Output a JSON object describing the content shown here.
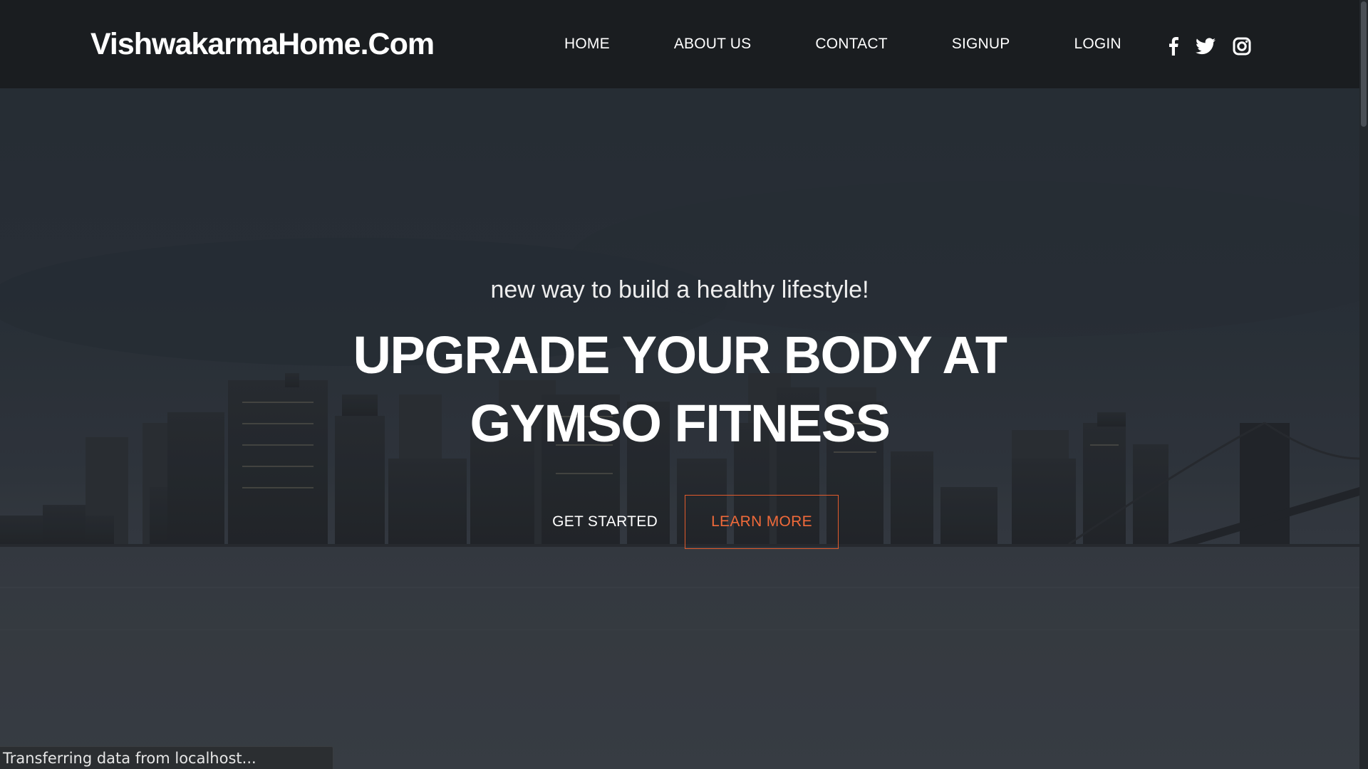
{
  "brand": {
    "name": "VishwakarmaHome.Com"
  },
  "nav": {
    "items": [
      {
        "label": "HOME"
      },
      {
        "label": "ABOUT US"
      },
      {
        "label": "CONTACT"
      },
      {
        "label": "SIGNUP"
      },
      {
        "label": "LOGIN"
      }
    ]
  },
  "social": {
    "icons": [
      "facebook-icon",
      "twitter-icon",
      "instagram-icon"
    ]
  },
  "hero": {
    "subtitle": "new way to build a healthy lifestyle!",
    "headline_line1": "UPGRADE YOUR BODY AT",
    "headline_line2": "GYMSO FITNESS",
    "primary_button": "GET STARTED",
    "secondary_button": "LEARN MORE",
    "background_image": "city-skyline-at-dusk"
  },
  "status_bar": {
    "text": "Transferring data from localhost..."
  },
  "colors": {
    "navbar": "#1a1d20",
    "accent": "#f06a3a",
    "text": "#ffffff"
  }
}
